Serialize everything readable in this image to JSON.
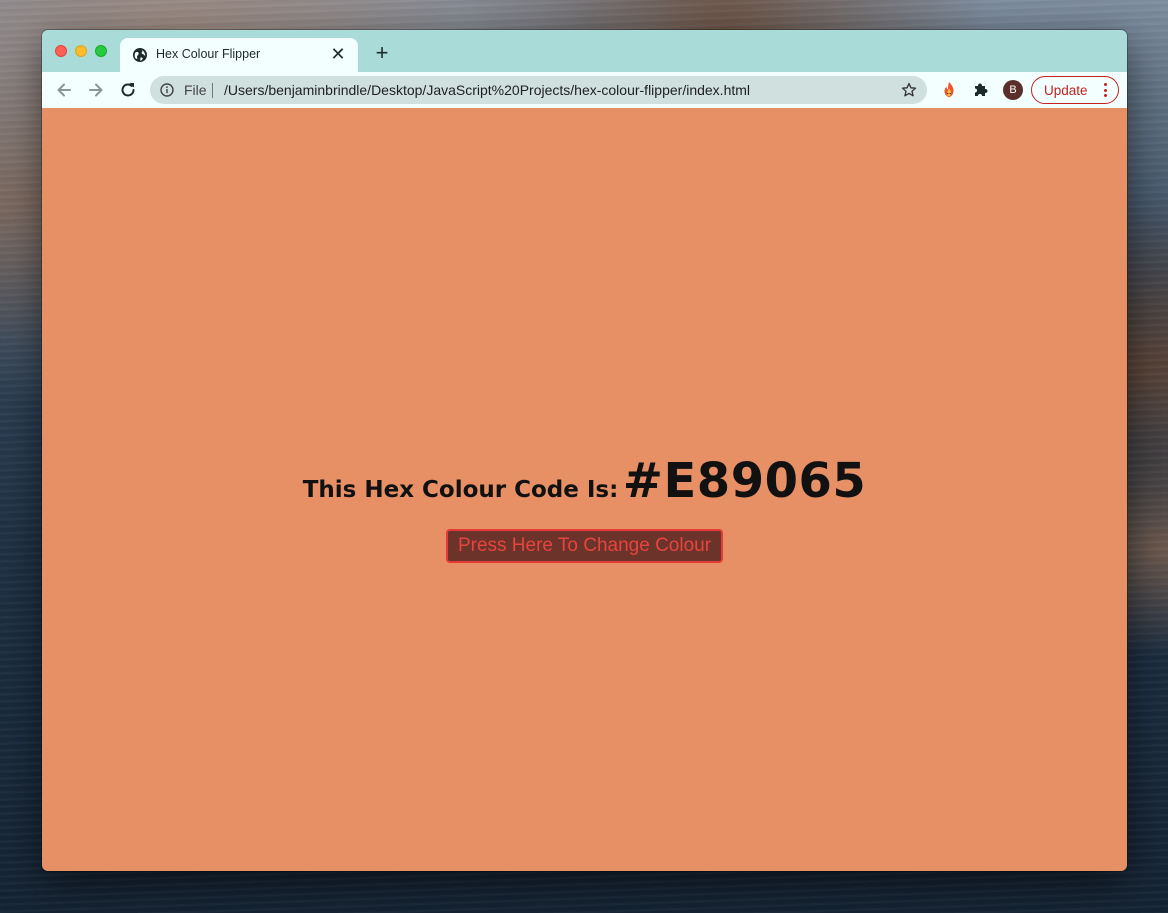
{
  "browser": {
    "tab": {
      "title": "Hex Colour Flipper",
      "close_glyph": "✕",
      "favicon": "globe-icon"
    },
    "new_tab_glyph": "+",
    "toolbar": {
      "back": "arrow-left-icon",
      "forward": "arrow-right-icon",
      "reload": "reload-icon"
    },
    "omnibox": {
      "scheme_label": "File",
      "url": "/Users/benjaminbrindle/Desktop/JavaScript%20Projects/hex-colour-flipper/index.html",
      "info_icon": "info-icon",
      "bookmark_icon": "star-icon"
    },
    "extensions": [
      "fire-extension-icon",
      "puzzle-icon"
    ],
    "profile_initial": "B",
    "update_label": "Update",
    "colors": {
      "frame": "#a9dcd8",
      "toolbar": "#f2fffe",
      "update_accent": "#c5221f"
    }
  },
  "page": {
    "background_color": "#E89065",
    "label": "This Hex Colour Code Is:",
    "hex": "#E89065",
    "button_label": "Press Here To Change Colour"
  }
}
